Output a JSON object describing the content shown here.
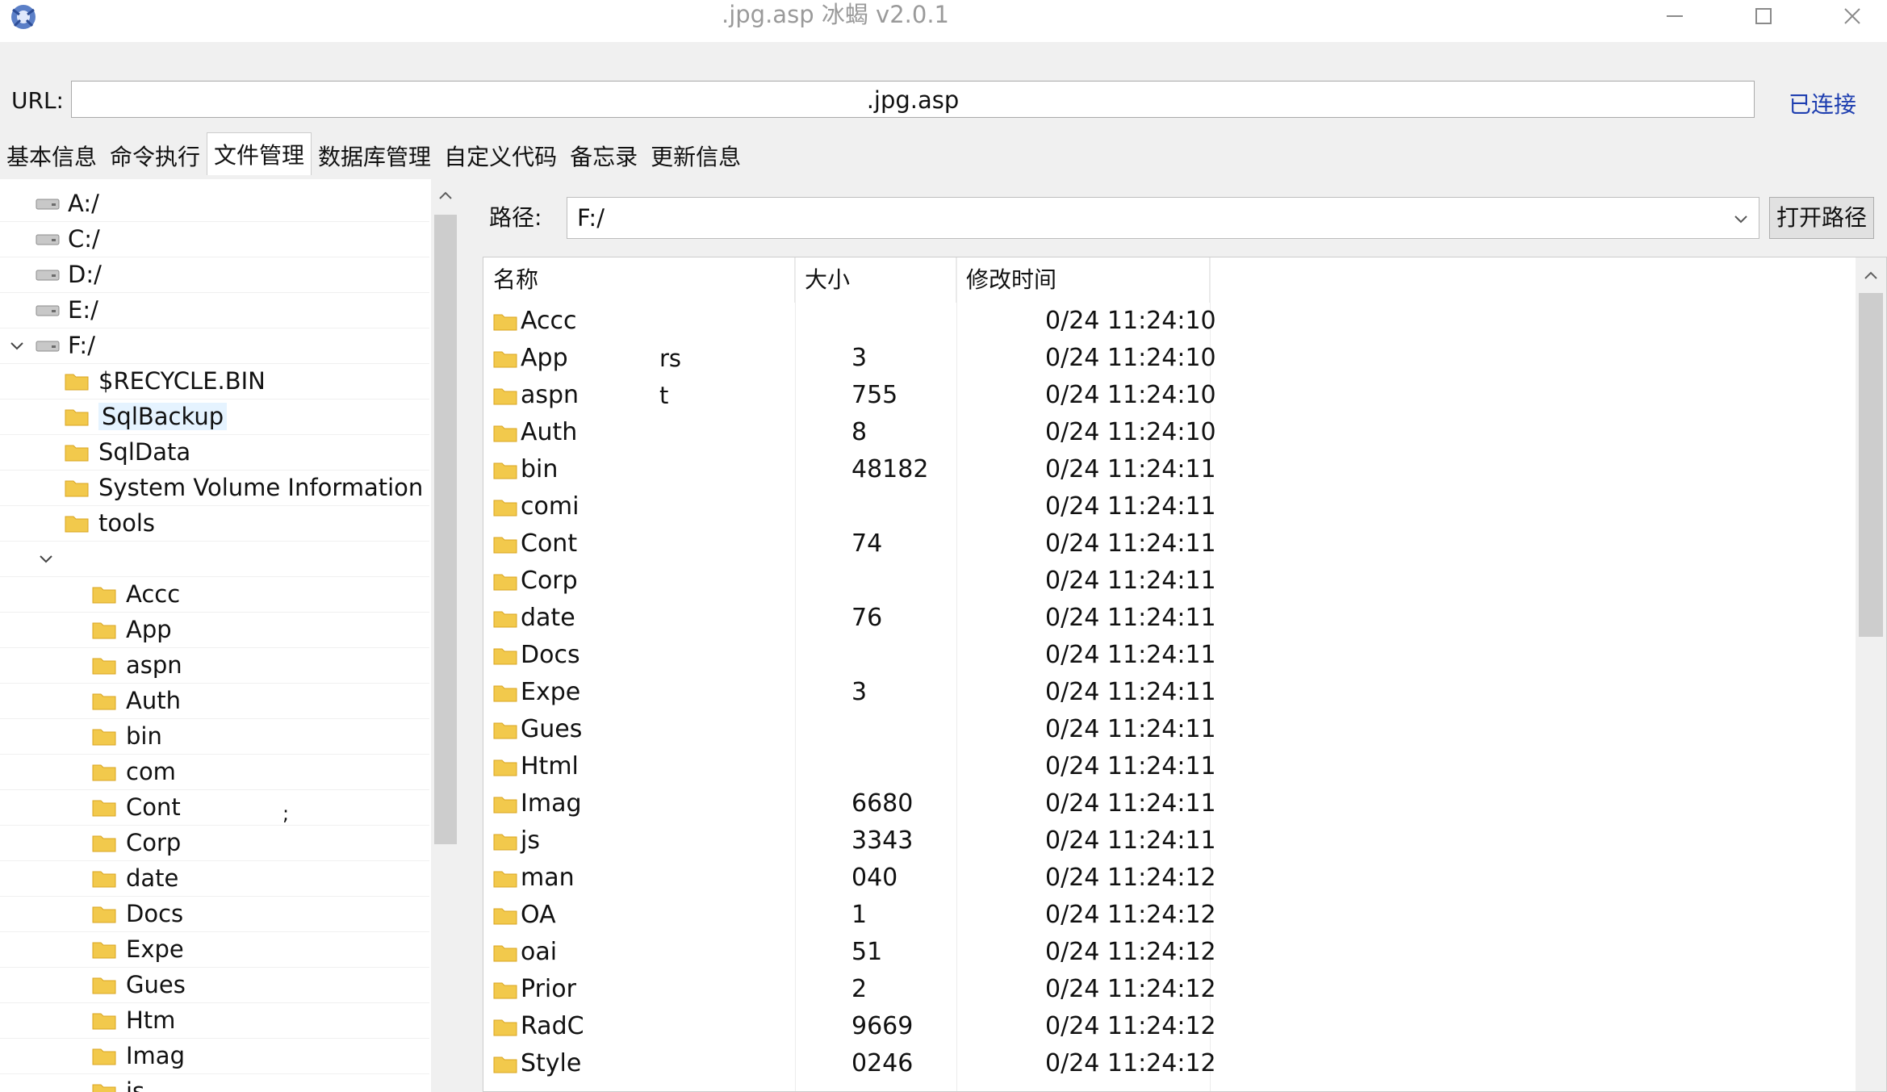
{
  "window": {
    "title": ".jpg.asp    冰蝎 v2.0.1",
    "icons": {
      "logo": "scorpion-logo-icon",
      "minimize": "minimize-icon",
      "maximize": "maximize-icon",
      "close": "close-icon"
    }
  },
  "url_bar": {
    "label": "URL:",
    "value": ".jpg.asp",
    "status": "已连接",
    "status_color": "#1f3fb0"
  },
  "tabs": [
    {
      "label": "基本信息",
      "active": false
    },
    {
      "label": "命令执行",
      "active": false
    },
    {
      "label": "文件管理",
      "active": true
    },
    {
      "label": "数据库管理",
      "active": false
    },
    {
      "label": "自定义代码",
      "active": false
    },
    {
      "label": "备忘录",
      "active": false
    },
    {
      "label": "更新信息",
      "active": false
    }
  ],
  "tree": {
    "drives": [
      {
        "label": "A:/"
      },
      {
        "label": "C:/"
      },
      {
        "label": "D:/"
      },
      {
        "label": "E:/"
      },
      {
        "label": "F:/",
        "expanded": true
      }
    ],
    "f_children": [
      {
        "label": "$RECYCLE.BIN"
      },
      {
        "label": "SqlBackup",
        "selected": true
      },
      {
        "label": "SqlData"
      },
      {
        "label": "System Volume Information"
      },
      {
        "label": "tools"
      }
    ],
    "sub_children": [
      {
        "label": "Accc"
      },
      {
        "label": "App"
      },
      {
        "label": "aspn"
      },
      {
        "label": "Auth"
      },
      {
        "label": "bin"
      },
      {
        "label": "com"
      },
      {
        "label": "Cont"
      },
      {
        "label": "Corp"
      },
      {
        "label": "date"
      },
      {
        "label": "Docs"
      },
      {
        "label": "Expe"
      },
      {
        "label": "Gues"
      },
      {
        "label": "Htm"
      },
      {
        "label": "Imag"
      },
      {
        "label": "js"
      }
    ],
    "stray_char": ";"
  },
  "path_bar": {
    "label": "路径:",
    "value": "F:/",
    "open_button": "打开路径"
  },
  "file_list": {
    "columns": {
      "name": "名称",
      "size": "大小",
      "mtime": "修改时间"
    },
    "rows": [
      {
        "name": "Accc",
        "frag": "",
        "size": "",
        "time": "0/24 11:24:10"
      },
      {
        "name": "App",
        "frag": "rs",
        "size": "3",
        "time": "0/24 11:24:10"
      },
      {
        "name": "aspn",
        "frag": "t",
        "size": "755",
        "time": "0/24 11:24:10"
      },
      {
        "name": "Auth",
        "frag": "",
        "size": "8",
        "time": "0/24 11:24:10"
      },
      {
        "name": "bin",
        "frag": "",
        "size": "48182",
        "time": "0/24 11:24:11"
      },
      {
        "name": "comi",
        "frag": "",
        "size": "",
        "time": "0/24 11:24:11"
      },
      {
        "name": "Cont",
        "frag": "",
        "size": "74",
        "time": "0/24 11:24:11"
      },
      {
        "name": "Corp",
        "frag": "",
        "size": "",
        "time": "0/24 11:24:11"
      },
      {
        "name": "date",
        "frag": "",
        "size": "76",
        "time": "0/24 11:24:11"
      },
      {
        "name": "Docs",
        "frag": "",
        "size": "",
        "time": "0/24 11:24:11"
      },
      {
        "name": "Expe",
        "frag": "",
        "size": "3",
        "time": "0/24 11:24:11"
      },
      {
        "name": "Gues",
        "frag": "",
        "size": "",
        "time": "0/24 11:24:11"
      },
      {
        "name": "Html",
        "frag": "",
        "size": "",
        "time": "0/24 11:24:11"
      },
      {
        "name": "Imag",
        "frag": "",
        "size": "6680",
        "time": "0/24 11:24:11"
      },
      {
        "name": "js",
        "frag": "",
        "size": "3343",
        "time": "0/24 11:24:11"
      },
      {
        "name": "man",
        "frag": "",
        "size": "040",
        "time": "0/24 11:24:12"
      },
      {
        "name": "OA",
        "frag": "",
        "size": "1",
        "time": "0/24 11:24:12"
      },
      {
        "name": "oai",
        "frag": "",
        "size": "51",
        "time": "0/24 11:24:12"
      },
      {
        "name": "Prior",
        "frag": "",
        "size": "2",
        "time": "0/24 11:24:12"
      },
      {
        "name": "RadC",
        "frag": "",
        "size": "9669",
        "time": "0/24 11:24:12"
      },
      {
        "name": "Style",
        "frag": "",
        "size": "0246",
        "time": "0/24 11:24:12"
      }
    ]
  },
  "colors": {
    "folder": "#f2c94c",
    "selected_row": "#e5f3ff",
    "window_bg": "#f0f0f0"
  }
}
